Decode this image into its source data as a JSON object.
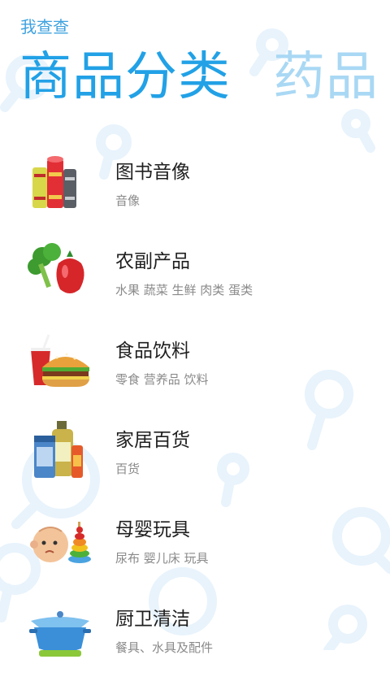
{
  "app": {
    "name": "我查查"
  },
  "pivot": {
    "current": "商品分类",
    "next": "药品"
  },
  "categories": [
    {
      "title": "图书音像",
      "subtitle": "音像",
      "icon": "books-icon"
    },
    {
      "title": "农副产品",
      "subtitle": "水果 蔬菜 生鲜 肉类 蛋类",
      "icon": "vegetables-icon"
    },
    {
      "title": "食品饮料",
      "subtitle": "零食 营养品 饮料",
      "icon": "burger-drink-icon"
    },
    {
      "title": "家居百货",
      "subtitle": "百货",
      "icon": "household-products-icon"
    },
    {
      "title": "母婴玩具",
      "subtitle": "尿布 婴儿床 玩具",
      "icon": "baby-toy-icon"
    },
    {
      "title": "厨卫清洁",
      "subtitle": "餐具、水具及配件",
      "icon": "cookware-icon"
    }
  ],
  "colors": {
    "accent": "#22a1e6",
    "accent_faded": "#a9d8f4",
    "app_name": "#3fa2df",
    "title_text": "#1f1f1f",
    "subtitle_text": "#8a8a8a",
    "background_decor": "#e8f3fc"
  }
}
